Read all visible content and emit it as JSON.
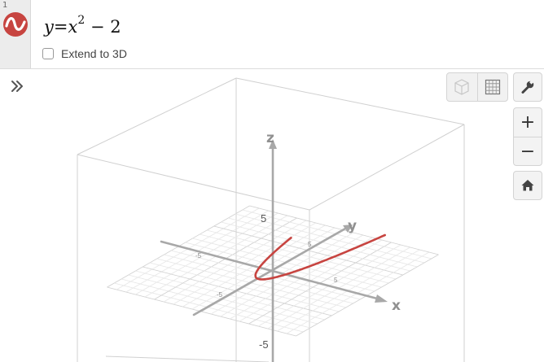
{
  "expression_list": {
    "items": [
      {
        "index": "1",
        "formula": {
          "lhs": "y",
          "equals": "=",
          "base": "x",
          "exponent": "2",
          "rest": "− 2"
        },
        "extend_3d_label": "Extend to 3D",
        "extend_3d_checked": false,
        "curve_color": "#c74440"
      }
    ]
  },
  "graph": {
    "axis_labels": {
      "x": "x",
      "y": "y",
      "z": "z"
    },
    "tick_labels": {
      "z_pos": "5",
      "z_neg": "-5",
      "y_pos": "5",
      "x_neg": "-5",
      "x_pos": "5",
      "y_neg": "-5"
    },
    "controls": {
      "expand_icon": "double-chevron-right-icon",
      "zoom_in_label": "+",
      "zoom_out_label": "−"
    },
    "colors": {
      "curve": "#c74440",
      "axis": "#a8a8a8",
      "grid": "#e2e2e2",
      "box": "#d0d0d0"
    }
  }
}
